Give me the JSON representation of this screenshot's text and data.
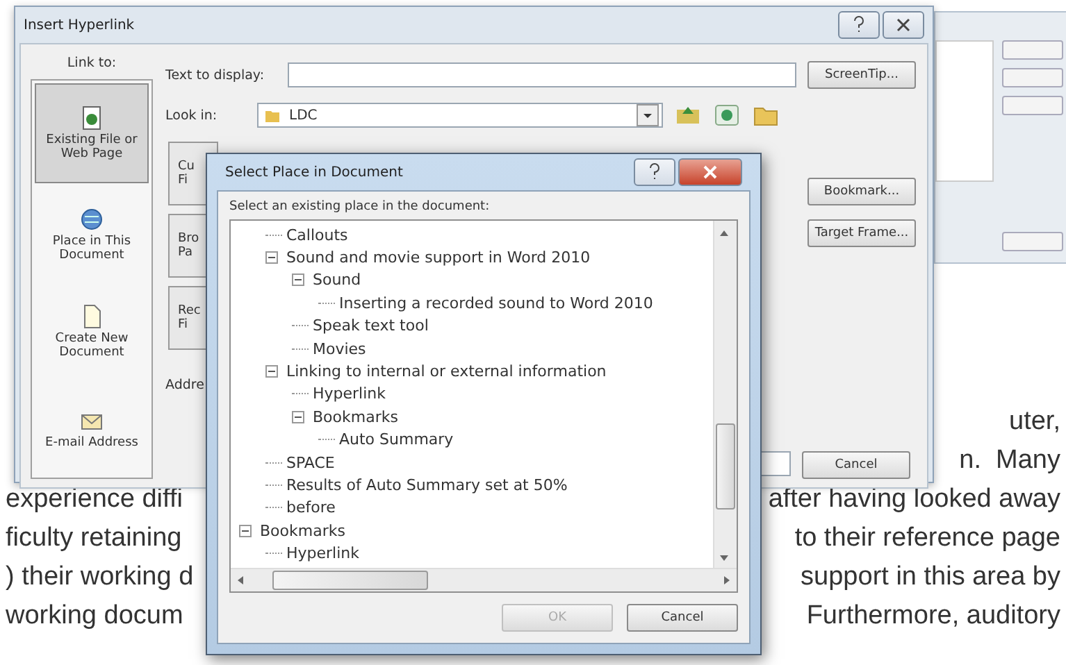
{
  "document": {
    "lines": [
      {
        "right": "uter,"
      },
      {
        "right": "n.  Many"
      },
      {
        "left": "experience diffi",
        "right": "after having looked away"
      },
      {
        "left": "ficulty retaining",
        "right": "to their reference page"
      },
      {
        "left": ") their working d",
        "right": "support in this area by"
      },
      {
        "left": "working docum",
        "right": "Furthermore, auditory"
      }
    ]
  },
  "insert_hyperlink": {
    "title": "Insert Hyperlink",
    "link_to_label": "Link to:",
    "link_targets": [
      {
        "kind": "file",
        "label": "Existing File or Web Page",
        "selected": true
      },
      {
        "kind": "place",
        "label": "Place in This Document",
        "selected": false
      },
      {
        "kind": "new",
        "label": "Create New Document",
        "selected": false
      },
      {
        "kind": "email",
        "label": "E-mail Address",
        "selected": false
      }
    ],
    "text_to_display_label": "Text to display:",
    "look_in": {
      "label": "Look in:",
      "value": "LDC"
    },
    "nav_buttons": [
      {
        "lines": [
          "Cu",
          "Fi"
        ]
      },
      {
        "lines": [
          "Bro",
          "Pa"
        ]
      },
      {
        "lines": [
          "Rec",
          "Fi"
        ]
      }
    ],
    "address_label": "Addre",
    "side_buttons": [
      "ScreenTip...",
      "Bookmark...",
      "Target Frame..."
    ],
    "cancel": "Cancel"
  },
  "select_place": {
    "title": "Select Place in Document",
    "prompt": "Select an existing place in the document:",
    "tree": [
      {
        "children": [
          {
            "label": "Callouts"
          },
          {
            "label": "Sound and movie support in Word 2010",
            "expanded": true,
            "children": [
              {
                "label": "Sound",
                "expanded": true,
                "children": [
                  {
                    "label": "Inserting a recorded sound to Word 2010"
                  }
                ]
              },
              {
                "label": "Speak text tool"
              },
              {
                "label": "Movies"
              }
            ]
          },
          {
            "label": "Linking to internal or external information",
            "expanded": true,
            "children": [
              {
                "label": "Hyperlink"
              },
              {
                "label": "Bookmarks",
                "expanded": true,
                "children": [
                  {
                    "label": "Auto Summary"
                  }
                ]
              }
            ]
          },
          {
            "label": "SPACE"
          },
          {
            "label": "Results of Auto Summary set at 50%"
          },
          {
            "label": "before"
          }
        ]
      },
      {
        "label": "Bookmarks",
        "expanded": true,
        "children": [
          {
            "label": "Hyperlink"
          }
        ]
      }
    ],
    "ok": {
      "label": "OK",
      "disabled": true
    },
    "cancel": "Cancel"
  }
}
